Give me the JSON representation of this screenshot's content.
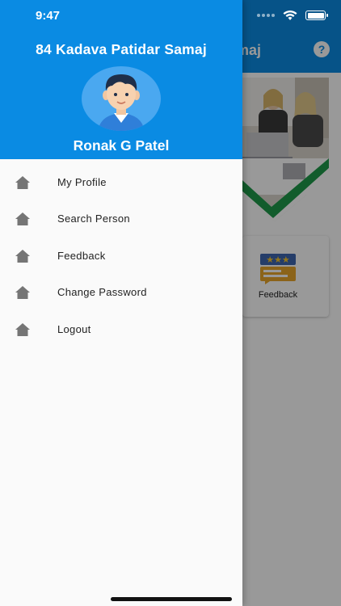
{
  "status_bar": {
    "time": "9:47"
  },
  "drawer": {
    "title": "84 Kadava Patidar Samaj",
    "user_name": "Ronak G Patel",
    "menu": [
      {
        "label": "My Profile",
        "icon": "home-icon"
      },
      {
        "label": "Search Person",
        "icon": "home-icon"
      },
      {
        "label": "Feedback",
        "icon": "home-icon"
      },
      {
        "label": "Change Password",
        "icon": "home-icon"
      },
      {
        "label": "Logout",
        "icon": "home-icon"
      }
    ]
  },
  "background_app": {
    "title": "84 Kadava Patidar Samaj",
    "help_icon": "question-icon",
    "cards": [
      {
        "label": "Feedback",
        "icon": "feedback-stars-icon"
      }
    ]
  },
  "colors": {
    "primary": "#0a8be3",
    "drawer_bg": "#fafafa",
    "icon_gray": "#757575",
    "text": "#222222"
  }
}
